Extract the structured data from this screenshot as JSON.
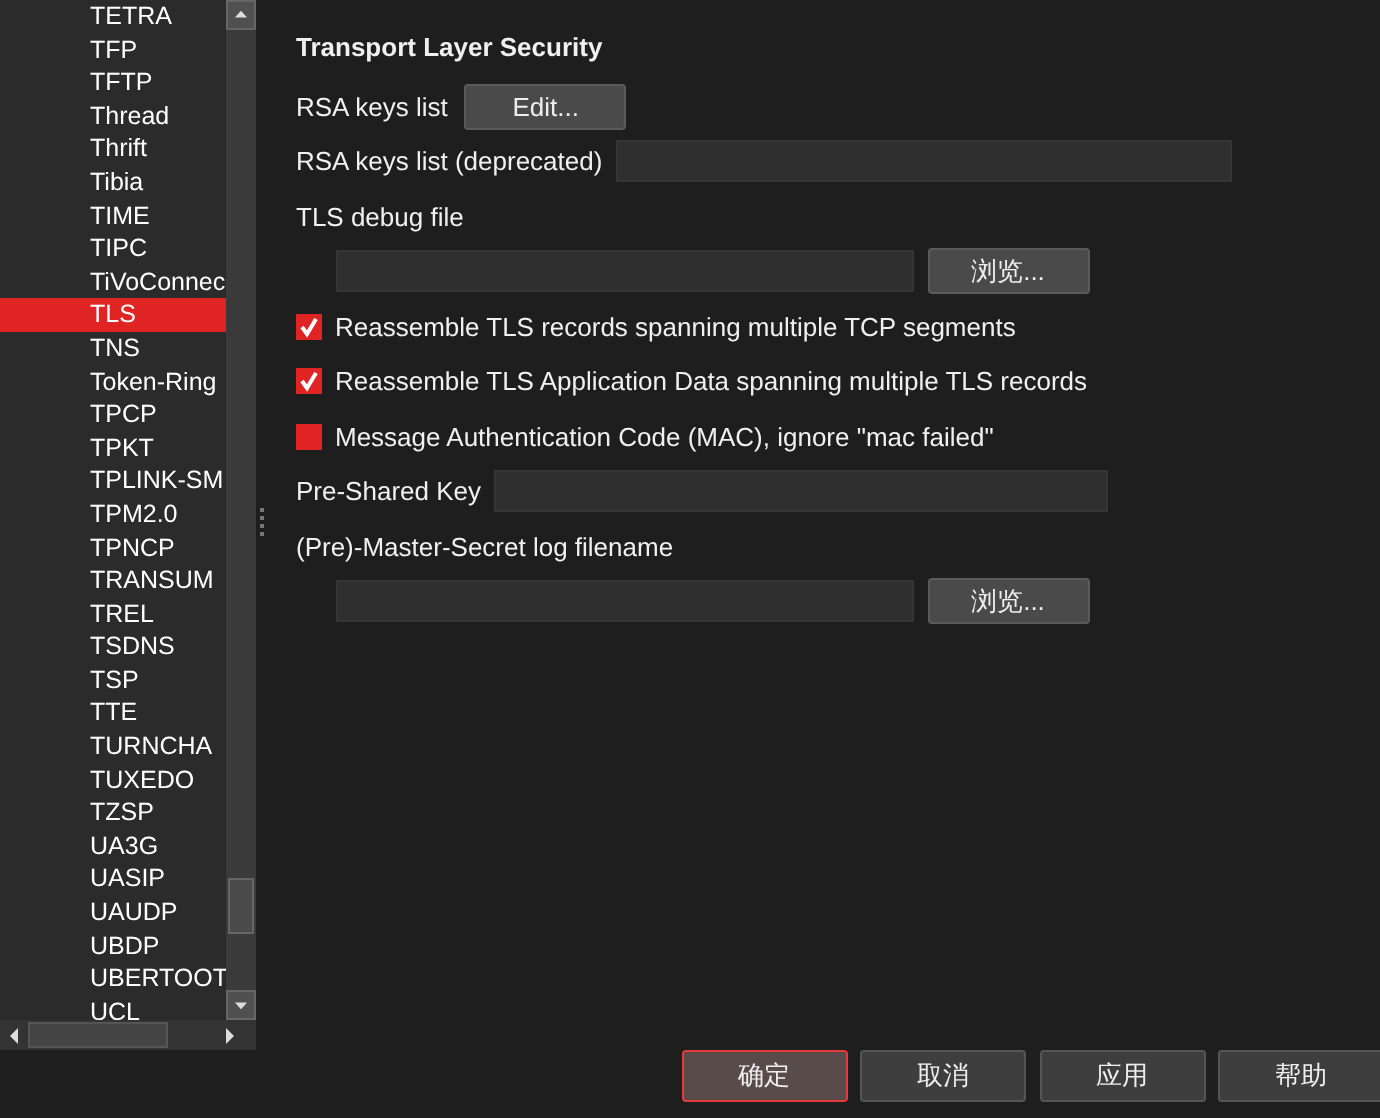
{
  "protocol_list": {
    "items": [
      {
        "label": "TETRA",
        "selected": false
      },
      {
        "label": "TFP",
        "selected": false
      },
      {
        "label": "TFTP",
        "selected": false
      },
      {
        "label": "Thread",
        "selected": false
      },
      {
        "label": "Thrift",
        "selected": false
      },
      {
        "label": "Tibia",
        "selected": false
      },
      {
        "label": "TIME",
        "selected": false
      },
      {
        "label": "TIPC",
        "selected": false
      },
      {
        "label": "TiVoConnec",
        "selected": false
      },
      {
        "label": "TLS",
        "selected": true
      },
      {
        "label": "TNS",
        "selected": false
      },
      {
        "label": "Token-Ring",
        "selected": false
      },
      {
        "label": "TPCP",
        "selected": false
      },
      {
        "label": "TPKT",
        "selected": false
      },
      {
        "label": "TPLINK-SM",
        "selected": false
      },
      {
        "label": "TPM2.0",
        "selected": false
      },
      {
        "label": "TPNCP",
        "selected": false
      },
      {
        "label": "TRANSUM",
        "selected": false
      },
      {
        "label": "TREL",
        "selected": false
      },
      {
        "label": "TSDNS",
        "selected": false
      },
      {
        "label": "TSP",
        "selected": false
      },
      {
        "label": "TTE",
        "selected": false
      },
      {
        "label": "TURNCHA",
        "selected": false
      },
      {
        "label": "TUXEDO",
        "selected": false
      },
      {
        "label": "TZSP",
        "selected": false
      },
      {
        "label": "UA3G",
        "selected": false
      },
      {
        "label": "UASIP",
        "selected": false
      },
      {
        "label": "UAUDP",
        "selected": false
      },
      {
        "label": "UBDP",
        "selected": false
      },
      {
        "label": "UBERTOOT",
        "selected": false
      },
      {
        "label": "UCL",
        "selected": false
      }
    ]
  },
  "settings": {
    "title": "Transport Layer Security",
    "rows": [
      {
        "kind": "button",
        "label": "RSA keys list",
        "button": "Edit..."
      },
      {
        "kind": "field",
        "label": "RSA keys list (deprecated)"
      },
      {
        "kind": "file",
        "label": "TLS debug file",
        "button": "浏览..."
      },
      {
        "kind": "check",
        "label": "Reassemble TLS records spanning multiple TCP segments",
        "checked": true
      },
      {
        "kind": "check",
        "label": "Reassemble TLS Application Data spanning multiple TLS records",
        "checked": true
      },
      {
        "kind": "check",
        "label": "Message Authentication Code (MAC), ignore \"mac failed\"",
        "checked": false
      },
      {
        "kind": "field",
        "label": "Pre-Shared Key"
      },
      {
        "kind": "file",
        "label": "(Pre)-Master-Secret log filename",
        "button": "浏览..."
      }
    ]
  },
  "buttons": [
    {
      "label": "确定",
      "selected": true
    },
    {
      "label": "取消",
      "selected": false
    },
    {
      "label": "应用",
      "selected": false
    },
    {
      "label": "帮助",
      "selected": false
    }
  ]
}
